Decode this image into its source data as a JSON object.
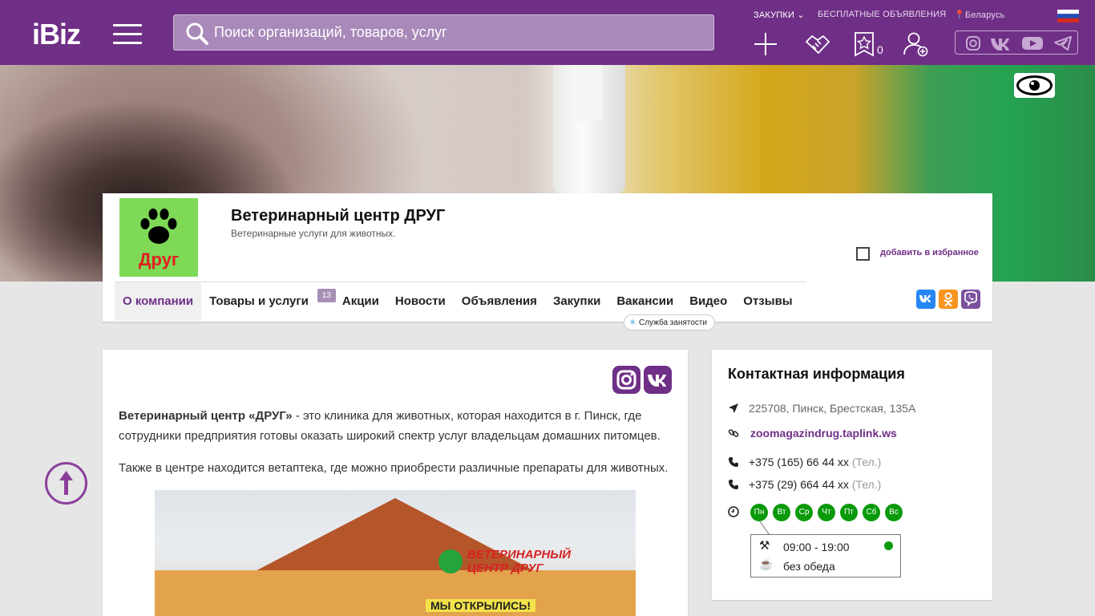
{
  "header": {
    "logo": "iBiz",
    "search_placeholder": "Поиск организаций, товаров, услуг",
    "nav_purchases": "ЗАКУПКИ",
    "nav_free_ads": "БЕСПЛАТНЫЕ ОБЪЯВЛЕНИЯ",
    "nav_region": "Беларусь",
    "favorites_count": "0"
  },
  "company": {
    "logo_text": "Друг",
    "title": "Ветеринарный центр ДРУГ",
    "subtitle": "Ветеринарные услуги для животных.",
    "add_favorite": "добавить в избранное"
  },
  "tabs": [
    {
      "label": "О компании"
    },
    {
      "label": "Товары и услуги",
      "badge": "13"
    },
    {
      "label": "Акции"
    },
    {
      "label": "Новости"
    },
    {
      "label": "Объявления"
    },
    {
      "label": "Закупки"
    },
    {
      "label": "Вакансии"
    },
    {
      "label": "Видео"
    },
    {
      "label": "Отзывы"
    }
  ],
  "employment_callout": "Служба занятости",
  "about": {
    "p1_bold": "Ветеринарный центр «ДРУГ»",
    "p1_line1": " - это клиника для животных, которая находится в г. Пинск, где",
    "p1_line2": "сотрудники предприятия  готовы оказать широкий спектр услуг владельцам домашних питомцев.",
    "p2": "Также в центре находится ветаптека, где можно приобрести различные препараты для животных.",
    "photo_sign": "ВЕТЕРИНАРНЫЙ ЦЕНТР ДРУГ",
    "photo_banner": "МЫ ОТКРЫЛИСЬ!"
  },
  "contacts": {
    "title": "Контактная информация",
    "address": "225708, Пинск, Брестская, 135А",
    "website": "zoomagazindrug.taplink.ws",
    "phone1": "+375 (165) 66 44 xx",
    "phone2": "+375 (29) 664 44 xx",
    "phone_label": "(Тел.)",
    "days": [
      "Пн",
      "Вт",
      "Ср",
      "Чт",
      "Пт",
      "Сб",
      "Вс"
    ],
    "work_hours": "09:00 - 19:00",
    "lunch": "без обеда"
  },
  "colors": {
    "brand": "#6f2f86",
    "open": "#0a9a0a"
  }
}
